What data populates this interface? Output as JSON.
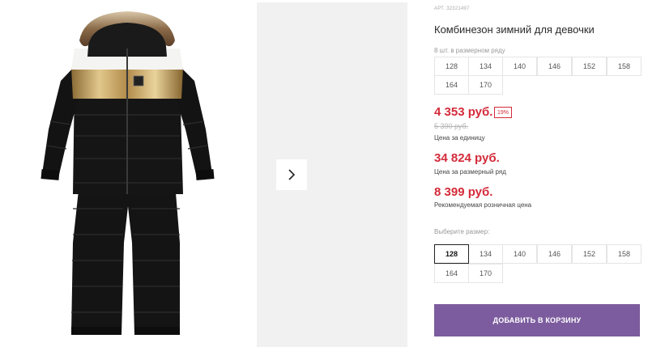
{
  "product": {
    "article_label": "АРТ.",
    "article_number": "32321497",
    "title": "Комбинезон зимний для девочки",
    "size_range_label": "8 шт. в размерном ряду",
    "size_range": [
      "128",
      "134",
      "140",
      "146",
      "152",
      "158",
      "164",
      "170"
    ],
    "unit_price": "4 353 руб.",
    "discount": "19%",
    "old_price": "5 390 руб.",
    "unit_price_caption": "Цена за единицу",
    "range_price": "34 824 руб.",
    "range_price_caption": "Цена за размерный ряд",
    "retail_price": "8 399 руб.",
    "retail_price_caption": "Рекомендуемая розничная цена",
    "choose_size_label": "Выберите размер:",
    "sizes": [
      "128",
      "134",
      "140",
      "146",
      "152",
      "158",
      "164",
      "170"
    ],
    "selected_size": "128",
    "add_to_cart_label": "ДОБАВИТЬ В КОРЗИНУ"
  },
  "gallery": {
    "main_image": "black-gold-winter-jumpsuit-photo",
    "next_icon": "chevron-right-icon"
  },
  "colors": {
    "price": "#d42b3a",
    "accent": "#7c5c9e",
    "jumpsuit": "#141414",
    "gold": "#c9a35c"
  }
}
